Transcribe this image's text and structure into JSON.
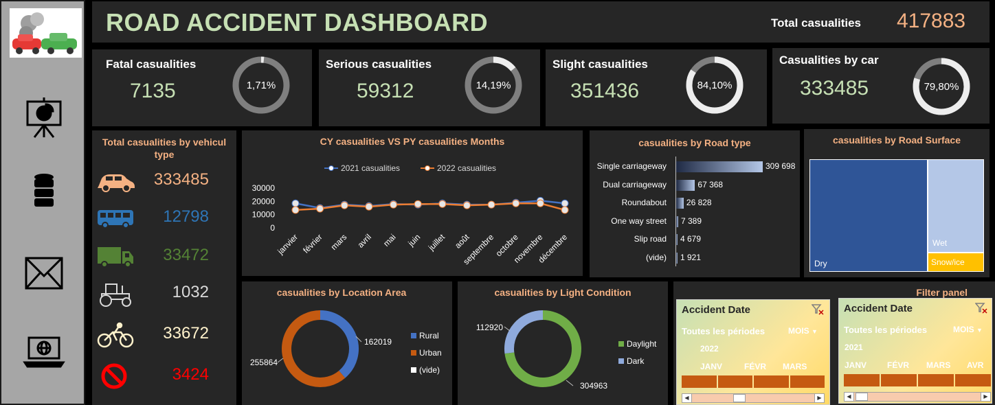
{
  "title": "ROAD ACCIDENT DASHBOARD",
  "total": {
    "label": "Total casualities",
    "value": "417883"
  },
  "kpis": [
    {
      "label": "Fatal casualities",
      "value": "7135",
      "pct": "1,71%",
      "fraction": 0.0171
    },
    {
      "label": "Serious casualities",
      "value": "59312",
      "pct": "14,19%",
      "fraction": 0.1419
    },
    {
      "label": "Slight casualities",
      "value": "351436",
      "pct": "84,10%",
      "fraction": 0.841
    },
    {
      "label": "Casualities by car",
      "value": "333485",
      "pct": "79,80%",
      "fraction": 0.798
    }
  ],
  "vehicle": {
    "title": "Total casualities by vehicul type",
    "items": [
      {
        "icon": "car-icon",
        "value": "333485",
        "color": "#f4b183"
      },
      {
        "icon": "bus-icon",
        "value": "12798",
        "color": "#2e75b6"
      },
      {
        "icon": "truck-icon",
        "value": "33472",
        "color": "#548235"
      },
      {
        "icon": "tractor-icon",
        "value": "1032",
        "color": "#d9d9d9"
      },
      {
        "icon": "bicycle-icon",
        "value": "33672",
        "color": "#fff2cc"
      },
      {
        "icon": "no-entry-icon",
        "value": "3424",
        "color": "#ff0000"
      }
    ]
  },
  "sidebar": {
    "icons": [
      "presentation-chart-icon",
      "database-icon",
      "mail-icon",
      "laptop-globe-icon"
    ]
  },
  "monthly": {
    "title": "CY casualities VS PY casualities Months",
    "chart_data": {
      "type": "line",
      "categories": [
        "janvier",
        "février",
        "mars",
        "avril",
        "mai",
        "juin",
        "juillet",
        "août",
        "septembre",
        "octobre",
        "novembre",
        "décembre"
      ],
      "series": [
        {
          "name": "2021 casualities",
          "color": "#4472c4",
          "values": [
            18500,
            15000,
            17500,
            16500,
            18000,
            17500,
            18500,
            17500,
            17500,
            19000,
            20500,
            18500
          ]
        },
        {
          "name": "2022 casualities",
          "color": "#ed7d31",
          "values": [
            13500,
            14500,
            17000,
            16000,
            17500,
            18000,
            18000,
            17000,
            17500,
            18500,
            18500,
            13500
          ]
        }
      ],
      "yticks": [
        "30000",
        "20000",
        "10000",
        "0"
      ],
      "ylim": [
        0,
        30000
      ]
    }
  },
  "road_type": {
    "title": "casualities by Road type",
    "chart_data": {
      "type": "bar",
      "categories": [
        "Single carriageway",
        "Dual carriageway",
        "Roundabout",
        "One way street",
        "Slip road",
        "(vide)"
      ],
      "values": [
        309698,
        67368,
        26828,
        7389,
        4679,
        1921
      ],
      "labels": [
        "309 698",
        "67 368",
        "26 828",
        "7 389",
        "4 679",
        "1 921"
      ]
    }
  },
  "road_surface": {
    "title": "casualities by Road Surface",
    "chart_data": {
      "type": "heatmap",
      "categories": [
        "Dry",
        "Wet",
        "Snow/ice"
      ]
    }
  },
  "location": {
    "title": "casualities by Location Area",
    "chart_data": {
      "type": "pie",
      "categories": [
        "Rural",
        "Urban",
        "(vide)"
      ],
      "values": [
        162019,
        255864,
        0
      ],
      "colors": [
        "#4472c4",
        "#c55a11",
        "#ffffff"
      ]
    }
  },
  "light": {
    "title": "casualities by Light Condition",
    "chart_data": {
      "type": "pie",
      "categories": [
        "Daylight",
        "Dark"
      ],
      "values": [
        304963,
        112920
      ],
      "colors": [
        "#70ad47",
        "#8faadc"
      ]
    }
  },
  "filter": {
    "title": "Filter panel",
    "slicers": [
      {
        "title": "Accident Date",
        "all": "Toutes les périodes",
        "unit": "MOIS",
        "year": "2022",
        "months": [
          "JANV",
          "FÉVR",
          "MARS"
        ]
      },
      {
        "title": "Accident Date",
        "all": "Toutes les périodes",
        "unit": "MOIS",
        "year": "2021",
        "months": [
          "JANV",
          "FÉVR",
          "MARS",
          "AVR"
        ]
      }
    ]
  }
}
